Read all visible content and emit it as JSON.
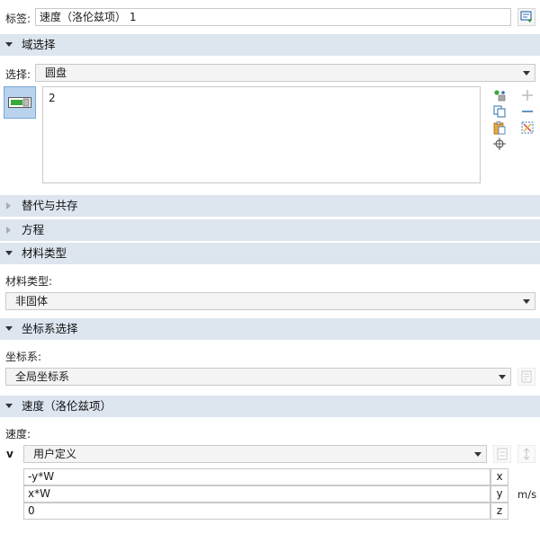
{
  "label_row": {
    "label": "标签:",
    "value": "速度（洛伦兹项） 1"
  },
  "domain_selection": {
    "header": "域选择",
    "select_label": "选择:",
    "select_value": "圆盘",
    "list_items": [
      "2"
    ]
  },
  "override": {
    "header": "替代与共存"
  },
  "equation": {
    "header": "方程"
  },
  "material_type": {
    "header": "材料类型",
    "field_label": "材料类型:",
    "value": "非固体"
  },
  "coordinate_system": {
    "header": "坐标系选择",
    "field_label": "坐标系:",
    "value": "全局坐标系"
  },
  "velocity": {
    "header": "速度（洛伦兹项）",
    "field_label": "速度:",
    "symbol": "v",
    "mode": "用户定义",
    "unit": "m/s",
    "components": [
      {
        "expr": "-y*W",
        "axis": "x"
      },
      {
        "expr": "x*W",
        "axis": "y"
      },
      {
        "expr": "0",
        "axis": "z"
      }
    ]
  },
  "colors": {
    "section_bg": "#dde5ef",
    "toggle_bg": "#b9d3ee",
    "green": "#3aa83a"
  },
  "icons": [
    "settings-panel-icon",
    "domain-toggle-icon",
    "paste-selection-icon",
    "copy-icon",
    "clipboard-icon",
    "zoom-selection-icon",
    "add-icon",
    "remove-icon",
    "clear-selection-icon",
    "coordinate-settings-icon",
    "coordinate-x-icon",
    "coordinate-y-icon"
  ]
}
